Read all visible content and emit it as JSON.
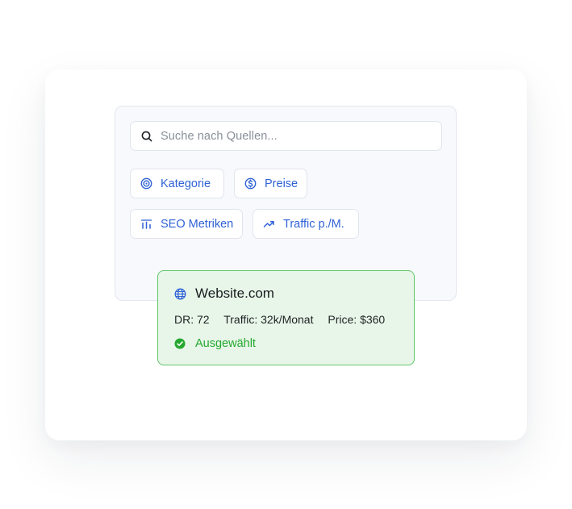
{
  "search": {
    "placeholder": "Suche nach Quellen...",
    "icon": "search-icon"
  },
  "filters": [
    {
      "label": "Kategorie",
      "icon": "target-icon"
    },
    {
      "label": "Preise",
      "icon": "dollar-circle-icon"
    },
    {
      "label": "SEO Metriken",
      "icon": "bar-chart-icon"
    },
    {
      "label": "Traffic p./M.",
      "icon": "trending-up-icon"
    }
  ],
  "result": {
    "title": "Website.com",
    "icon": "globe-icon",
    "dr": "DR: 72",
    "traffic": "Traffic: 32k/Monat",
    "price": "Price: $360",
    "status": "Ausgewählt",
    "status_icon": "check-circle-icon"
  },
  "colors": {
    "accent": "#2f62d6",
    "success": "#24a82f",
    "success_bg": "#e7f6e8",
    "success_border": "#62c76c"
  }
}
